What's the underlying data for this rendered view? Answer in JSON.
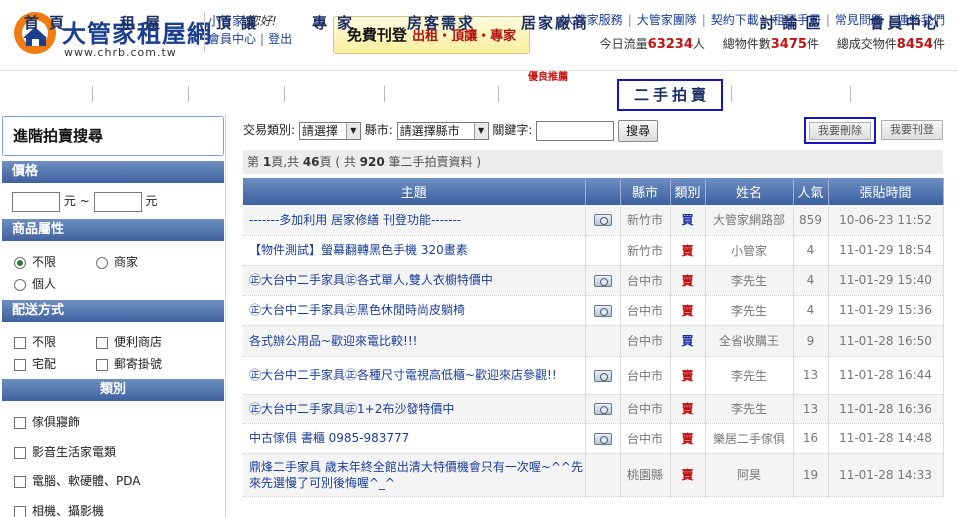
{
  "logo": {
    "name": "大管家租屋網",
    "url": "www.chrb.com.tw"
  },
  "user": {
    "name": "小管家",
    "greeting": ",您好!",
    "member_center": "會員中心",
    "logout": "登出",
    "separator": "|"
  },
  "promo": {
    "lead": "免費刊登",
    "items": "出租・頂讓・專家"
  },
  "topnav": {
    "items": [
      "大管家服務",
      "大管家團隊",
      "契約下載",
      "租屋手冊",
      "常見問題",
      "連絡我們"
    ]
  },
  "stats": {
    "today_label": "今日流量",
    "today_value": "63234",
    "today_unit": "人",
    "total_label": "總物件數",
    "total_value": "3475",
    "total_unit": "件",
    "deal_label": "總成交物件",
    "deal_value": "8454",
    "deal_unit": "件"
  },
  "mainnav": {
    "items": [
      "首頁",
      "租屋",
      "頂讓",
      "專家",
      "房客需求",
      "居家廠商",
      "二手拍賣",
      "討論區",
      "會員中心"
    ],
    "badge": "優良推薦",
    "active_index": 6
  },
  "sidebar": {
    "title": "進階拍賣搜尋",
    "price": {
      "label": "價格",
      "unit": "元",
      "tilde": "~"
    },
    "attr": {
      "label": "商品屬性",
      "options": [
        "不限",
        "商家",
        "個人"
      ]
    },
    "delivery": {
      "label": "配送方式",
      "options": [
        "不限",
        "便利商店",
        "宅配",
        "郵寄掛號"
      ]
    },
    "category": {
      "label": "類別",
      "options": [
        "傢俱寢飾",
        "影音生活家電類",
        "電腦、軟硬體、PDA",
        "相機、攝影機"
      ]
    }
  },
  "search": {
    "type_label": "交易類別:",
    "type_value": "請選擇",
    "city_label": "縣市:",
    "city_value": "請選擇縣市",
    "keyword_label": "關鍵字:",
    "keyword_value": "",
    "submit": "搜尋"
  },
  "actions": {
    "delete": "我要刪除",
    "post": "我要刊登"
  },
  "pageinfo": {
    "prefix": "第 ",
    "page": "1",
    "mid1": "頁,共 ",
    "pages": "46",
    "mid2": "頁 ( 共 ",
    "count": "920",
    "suffix": " 筆二手拍賣資料 )"
  },
  "table": {
    "headers": [
      "主題",
      "",
      "縣市",
      "類別",
      "姓名",
      "人氣",
      "張貼時間"
    ],
    "rows": [
      {
        "title": "-------多加利用 居家修繕 刊登功能-------",
        "photo": true,
        "city": "新竹市",
        "type": "買",
        "name": "大管家網路部",
        "views": "859",
        "time": "10-06-23 11:52"
      },
      {
        "title": "【物件測試】螢幕翻轉黑色手機 320畫素",
        "photo": false,
        "city": "新竹市",
        "type": "賣",
        "name": "小管家",
        "views": "4",
        "time": "11-01-29 18:54"
      },
      {
        "title": "㊣大台中二手家具㊣各式單人,雙人衣櫥特價中",
        "photo": true,
        "city": "台中市",
        "type": "賣",
        "name": "李先生",
        "views": "4",
        "time": "11-01-29 15:40"
      },
      {
        "title": "㊣大台中二手家具㊣黑色休閒時尚皮躺椅",
        "photo": true,
        "city": "台中市",
        "type": "賣",
        "name": "李先生",
        "views": "4",
        "time": "11-01-29 15:36"
      },
      {
        "title": "各式辦公用品~歡迎來電比較!!!",
        "photo": false,
        "city": "台中市",
        "type": "買",
        "name": "全省收購王",
        "views": "9",
        "time": "11-01-28 16:50"
      },
      {
        "title": "㊣大台中二手家具㊣各種尺寸電視高低櫃~歡迎來店參觀!!",
        "photo": true,
        "city": "台中市",
        "type": "賣",
        "name": "李先生",
        "views": "13",
        "time": "11-01-28 16:44"
      },
      {
        "title": "㊣大台中二手家具㊣1+2布沙發特價中",
        "photo": true,
        "city": "台中市",
        "type": "賣",
        "name": "李先生",
        "views": "13",
        "time": "11-01-28 16:36"
      },
      {
        "title": "中古傢俱 書櫃 0985-983777",
        "photo": true,
        "city": "台中市",
        "type": "賣",
        "name": "樂居二手傢俱",
        "views": "16",
        "time": "11-01-28 14:48"
      },
      {
        "title": "鼎烽二手家具 歲末年終全館出清大特價機會只有一次喔~^^先來先選慢了可別後悔喔^_^",
        "photo": false,
        "city": "桃園縣",
        "type": "賣",
        "name": "阿昊",
        "views": "19",
        "time": "11-01-28 14:33"
      }
    ]
  },
  "colors": {
    "brand_blue": "#1b3f8f",
    "logo_orange": "#f07c10",
    "nav_text": "#1c2f63",
    "highlight_box": "#1414c8",
    "stat_red": "#c41212",
    "header_blue": "#3c5f9f"
  },
  "icons": {
    "photo": "camera-icon",
    "radio": "radio-button",
    "checkbox": "checkbox"
  }
}
